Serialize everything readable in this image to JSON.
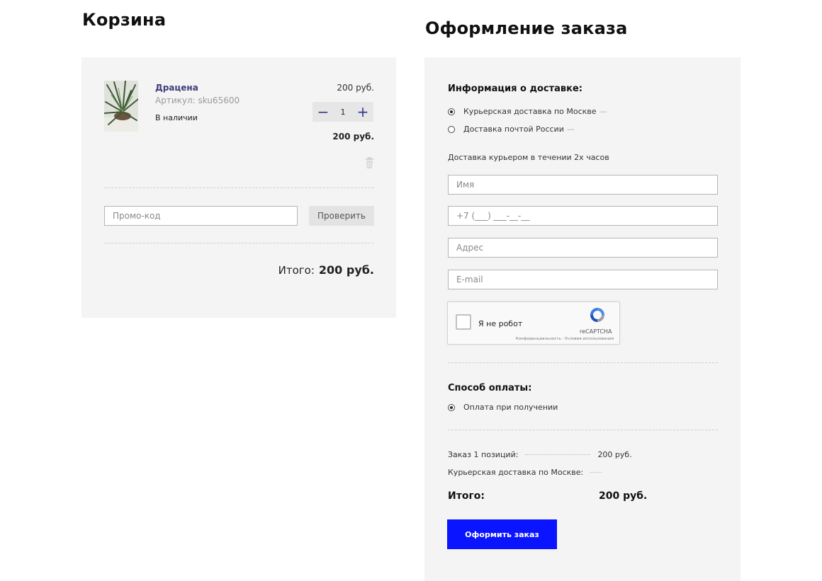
{
  "cart": {
    "title": "Корзина",
    "item": {
      "name": "Драцена",
      "sku": "Артикул: sku65600",
      "stock": "В наличии",
      "unit_price": "200 руб.",
      "quantity": "1",
      "line_total": "200 руб."
    },
    "promo": {
      "placeholder": "Промо-код",
      "check_label": "Проверить"
    },
    "total": {
      "label": "Итого:",
      "value": "200 руб."
    }
  },
  "checkout": {
    "title": "Оформление заказа",
    "delivery": {
      "title": "Информация о доставке:",
      "options": [
        {
          "label": "Курьерская доставка по Москве",
          "suffix": "—",
          "selected": true
        },
        {
          "label": "Доставка почтой России",
          "suffix": "—",
          "selected": false
        }
      ],
      "note": "Доставка курьером в течении 2х часов"
    },
    "fields": {
      "name_placeholder": "Имя",
      "phone_placeholder": "+7 (___) ___-__-__",
      "address_placeholder": "Адрес",
      "email_placeholder": "E-mail"
    },
    "captcha": {
      "label": "Я не робот",
      "brand": "reCAPTCHA",
      "links": "Конфиденциальность - Условия использования"
    },
    "payment": {
      "title": "Способ оплаты:",
      "option": "Оплата при получении"
    },
    "summary": {
      "order_label": "Заказ 1 позиций:",
      "order_value": "200 руб.",
      "delivery_label": "Курьерская доставка по Москве:",
      "total_label": "Итого:",
      "total_value": "200 руб."
    },
    "submit_label": "Оформить заказ"
  },
  "colors": {
    "accent": "#0a14ff",
    "panel": "#f4f4f4",
    "product_link": "#3e3c78",
    "stepper": "#2e3a8c"
  }
}
